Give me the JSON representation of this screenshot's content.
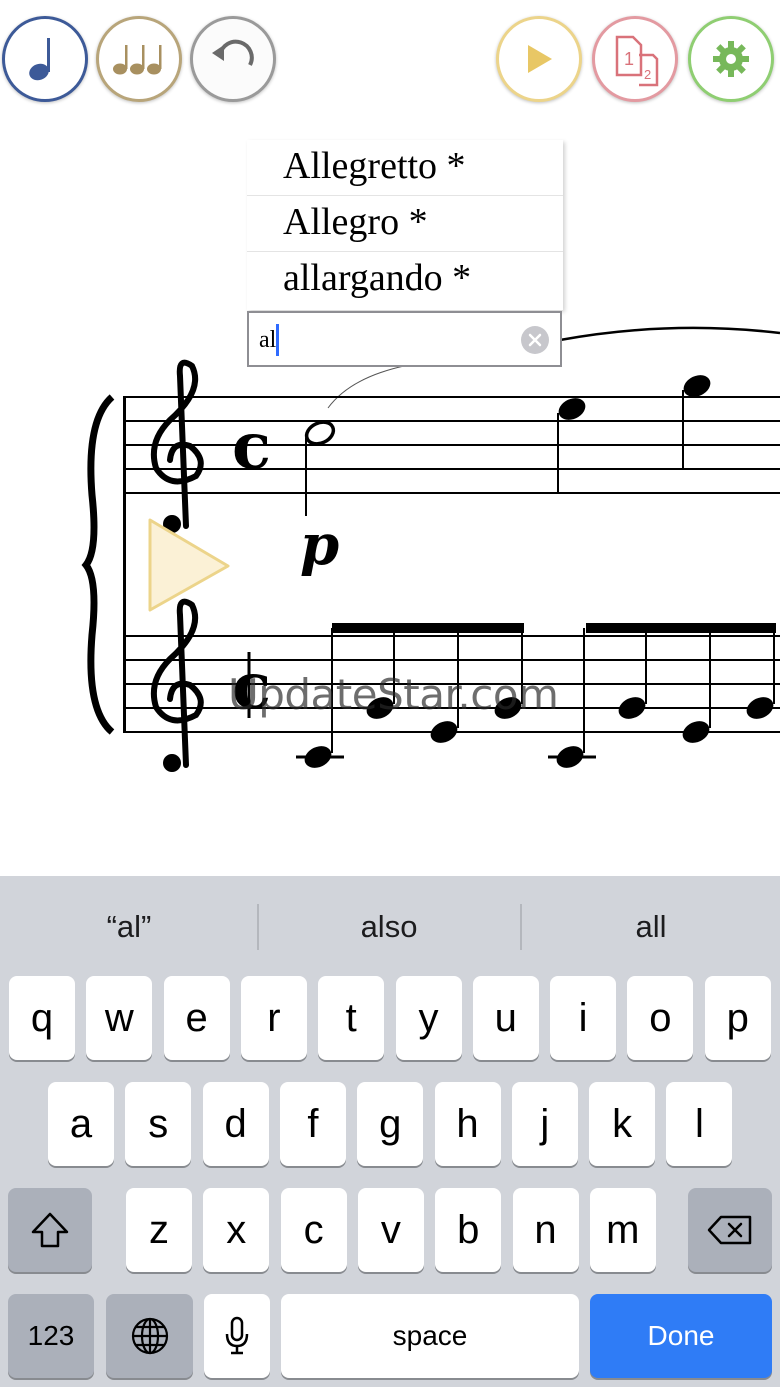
{
  "toolbar": {
    "buttons": [
      {
        "name": "note-input-button",
        "icon": "quarter-note-icon",
        "color": "#3d5a98"
      },
      {
        "name": "note-groups-button",
        "icon": "triple-notes-icon",
        "color": "#a89060"
      },
      {
        "name": "undo-button",
        "icon": "undo-icon",
        "color": "#8e8e8e"
      },
      {
        "name": "play-button",
        "icon": "play-icon",
        "color": "#e8c765"
      },
      {
        "name": "pages-button",
        "icon": "pages-icon",
        "color": "#d9727a"
      },
      {
        "name": "settings-button",
        "icon": "gear-icon",
        "color": "#77b85a"
      }
    ],
    "pages_label_1": "1",
    "pages_label_2": "2"
  },
  "suggestions": [
    "Allegretto *",
    "Allegro *",
    "allargando *"
  ],
  "tempo_input": {
    "value": "al"
  },
  "score": {
    "dynamic": "p",
    "time_signature_top": "c",
    "time_signature_bottom": "c"
  },
  "watermark": "UpdateStar.com",
  "keyboard": {
    "predictions": [
      "“al”",
      "also",
      "all"
    ],
    "row1": [
      "q",
      "w",
      "e",
      "r",
      "t",
      "y",
      "u",
      "i",
      "o",
      "p"
    ],
    "row2": [
      "a",
      "s",
      "d",
      "f",
      "g",
      "h",
      "j",
      "k",
      "l"
    ],
    "row3": [
      "z",
      "x",
      "c",
      "v",
      "b",
      "n",
      "m"
    ],
    "numbers_label": "123",
    "space_label": "space",
    "done_label": "Done",
    "done_color": "#2f7cf6"
  }
}
